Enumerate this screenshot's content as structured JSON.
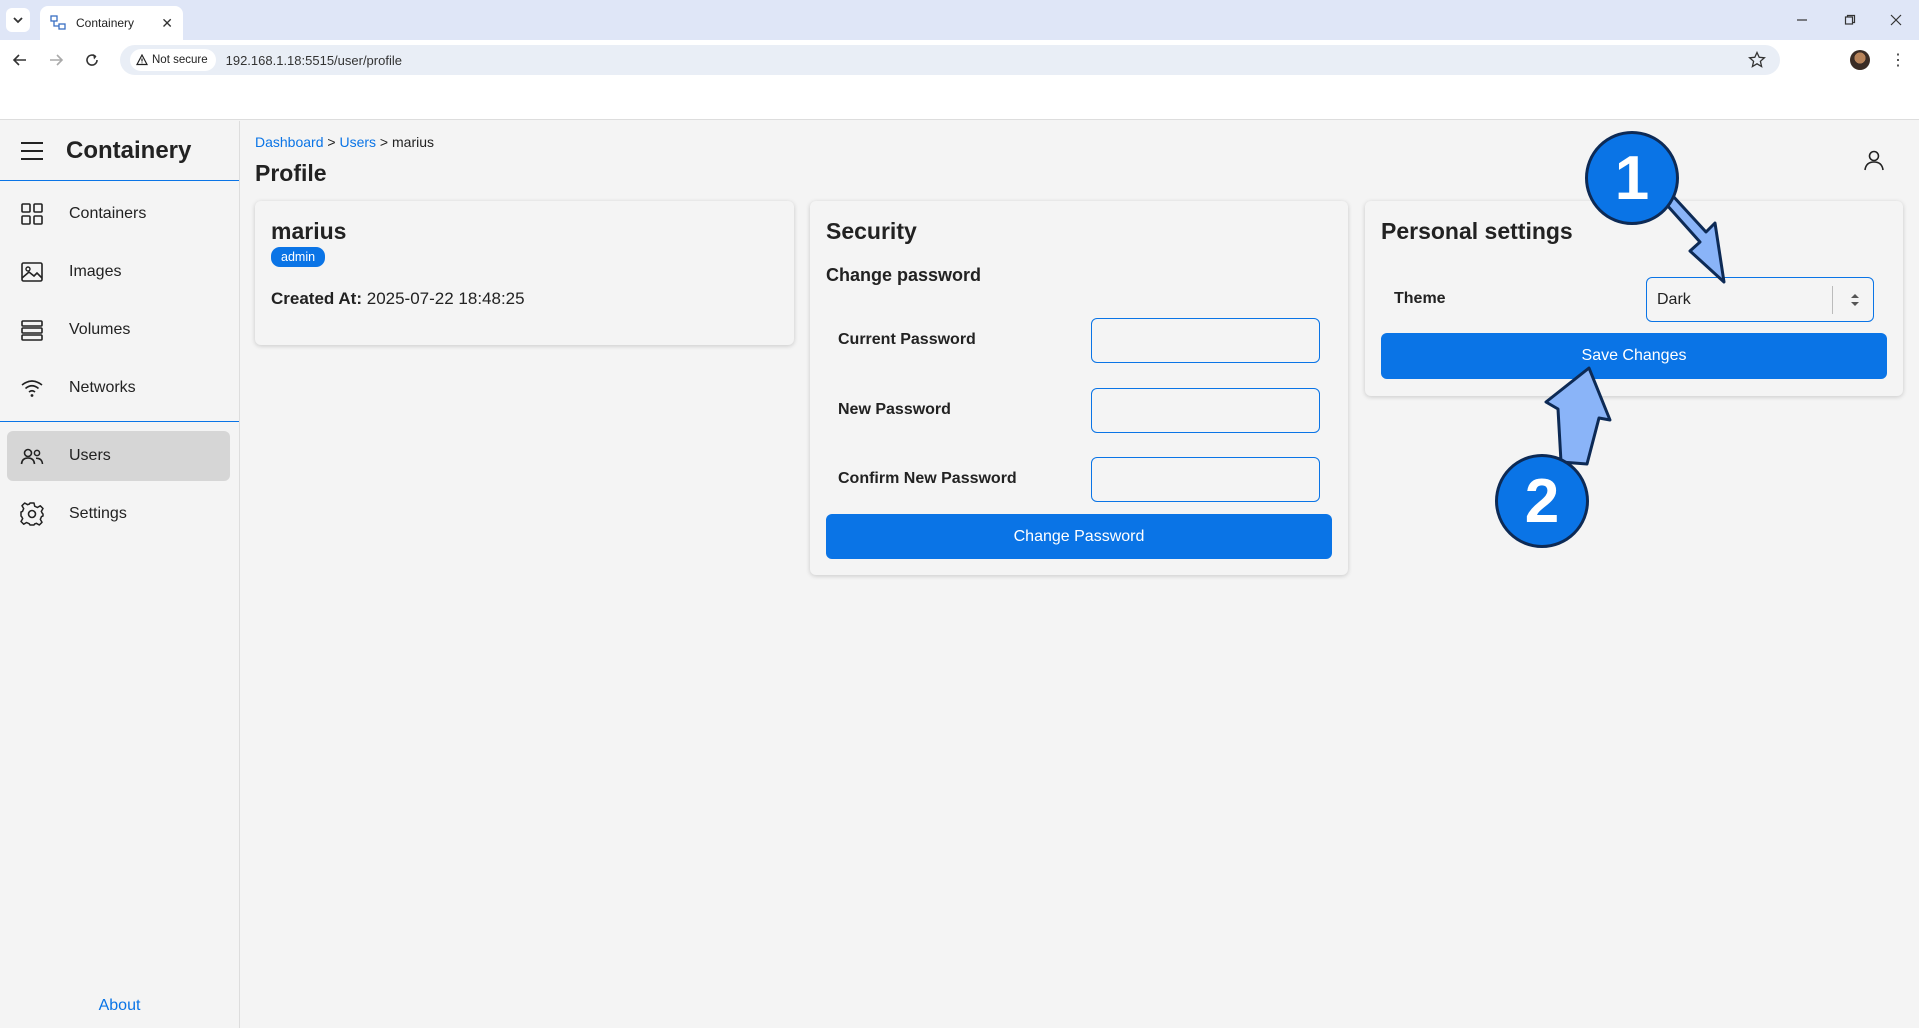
{
  "browser": {
    "tab_title": "Containery",
    "security_label": "Not secure",
    "url": "192.168.1.18:5515/user/profile"
  },
  "sidebar": {
    "app_name": "Containery",
    "items": [
      {
        "label": "Containers",
        "icon": "grid-icon"
      },
      {
        "label": "Images",
        "icon": "image-icon"
      },
      {
        "label": "Volumes",
        "icon": "volumes-icon"
      },
      {
        "label": "Networks",
        "icon": "wifi-icon"
      },
      {
        "label": "Users",
        "icon": "users-icon",
        "active": true
      },
      {
        "label": "Settings",
        "icon": "gear-icon"
      }
    ],
    "about_label": "About"
  },
  "breadcrumb": {
    "items": [
      "Dashboard",
      "Users",
      "marius"
    ],
    "separator": ">"
  },
  "page": {
    "title": "Profile"
  },
  "user_card": {
    "username": "marius",
    "role": "admin",
    "created_label": "Created At:",
    "created_value": "2025-07-22 18:48:25"
  },
  "security_card": {
    "title": "Security",
    "subtitle": "Change password",
    "fields": [
      {
        "label": "Current Password",
        "value": ""
      },
      {
        "label": "New Password",
        "value": ""
      },
      {
        "label": "Confirm New Password",
        "value": ""
      }
    ],
    "button_label": "Change Password"
  },
  "personal_card": {
    "title": "Personal settings",
    "theme_label": "Theme",
    "theme_value": "Dark",
    "save_label": "Save Changes"
  },
  "annotations": {
    "step1": "1",
    "step2": "2"
  },
  "colors": {
    "accent": "#0a74e6",
    "annotation_arrow": "#8ab4f8"
  }
}
